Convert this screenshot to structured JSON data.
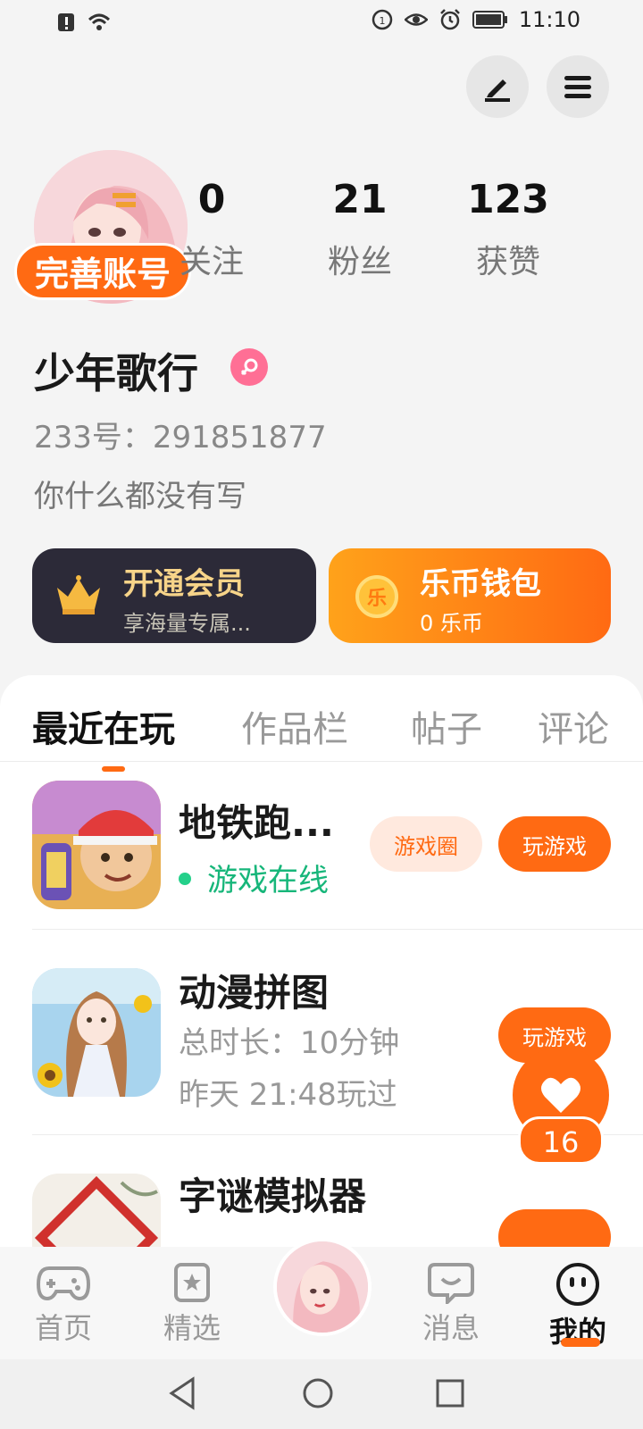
{
  "status_bar": {
    "time": "11:10",
    "left_icons": [
      "alert-icon",
      "wifi-icon"
    ],
    "right_icons": [
      "data-saver-icon",
      "eye-icon",
      "alarm-icon",
      "battery-icon"
    ]
  },
  "header": {
    "edit_icon": "edit-icon",
    "menu_icon": "menu-icon"
  },
  "profile": {
    "complete_account_label": "完善账号",
    "stats": {
      "following": {
        "value": "0",
        "label": "关注"
      },
      "fans": {
        "value": "21",
        "label": "粉丝"
      },
      "likes": {
        "value": "123",
        "label": "获赞"
      }
    },
    "username": "少年歌行",
    "gender_icon": "female-icon",
    "uid": "233号：291851877",
    "bio": "你什么都没有写"
  },
  "cards": {
    "vip": {
      "title": "开通会员",
      "subtitle": "享海量专属..."
    },
    "wallet": {
      "title": "乐币钱包",
      "subtitle": "0 乐币",
      "coin_char": "乐"
    }
  },
  "tabs": [
    {
      "label": "最近在玩",
      "active": true
    },
    {
      "label": "作品栏",
      "active": false
    },
    {
      "label": "帖子",
      "active": false
    },
    {
      "label": "评论",
      "active": false
    }
  ],
  "games": [
    {
      "name": "地铁跑...",
      "status": "游戏在线",
      "circle_label": "游戏圈",
      "play_label": "玩游戏"
    },
    {
      "name": "动漫拼图",
      "total_time": "总时长：10分钟",
      "last_played": "昨天 21:48玩过",
      "play_label": "玩游戏"
    },
    {
      "name": "字谜模拟器"
    }
  ],
  "floating_like": {
    "count": "16"
  },
  "bottom_nav": {
    "home": "首页",
    "featured": "精选",
    "messages": "消息",
    "mine": "我的"
  },
  "colors": {
    "accent": "#ff6a13",
    "online": "#17b67a",
    "vip_bg": "#2c2a38",
    "vip_text": "#f7d489"
  }
}
